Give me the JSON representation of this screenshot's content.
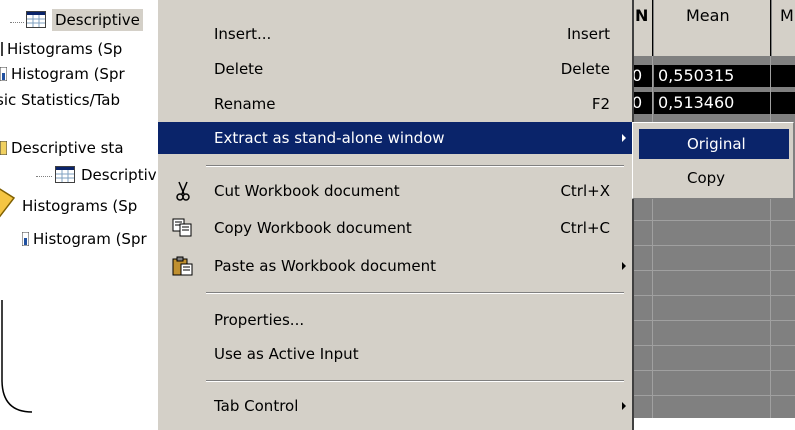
{
  "tree": {
    "rows": [
      {
        "label": "Descriptive"
      },
      {
        "label": "Histograms (Sp"
      },
      {
        "label": "Histogram (Spr"
      },
      {
        "label": "sic Statistics/Tab"
      },
      {
        "label": "Descriptive sta"
      },
      {
        "label": "Descriptive"
      },
      {
        "label": "Histograms (Sp"
      },
      {
        "label": "Histogram (Spr"
      }
    ]
  },
  "grid": {
    "headers": [
      "N",
      "Mean",
      "M"
    ],
    "rows": [
      {
        "n": "0",
        "mean": "0,550315"
      },
      {
        "n": "0",
        "mean": "0,513460"
      }
    ]
  },
  "menu": {
    "items": [
      {
        "label": "Insert...",
        "shortcut": "Insert"
      },
      {
        "label": "Delete",
        "shortcut": "Delete"
      },
      {
        "label": "Rename",
        "shortcut": "F2"
      },
      {
        "label": "Extract as stand-alone window",
        "shortcut": ""
      },
      {
        "label": "Cut Workbook document",
        "shortcut": "Ctrl+X"
      },
      {
        "label": "Copy Workbook document",
        "shortcut": "Ctrl+C"
      },
      {
        "label": "Paste as Workbook document",
        "shortcut": ""
      },
      {
        "label": "Properties...",
        "shortcut": ""
      },
      {
        "label": "Use as Active Input",
        "shortcut": ""
      },
      {
        "label": "Tab Control",
        "shortcut": ""
      }
    ],
    "icons": [
      "scissors-icon",
      "copy-icon",
      "paste-icon"
    ]
  },
  "submenu": {
    "items": [
      {
        "label": "Original"
      },
      {
        "label": "Copy"
      }
    ]
  },
  "colors": {
    "menu_bg": "#d4d0c8",
    "highlight": "#0a246a",
    "grid_bg": "#808080",
    "callout": "#f5c542"
  }
}
